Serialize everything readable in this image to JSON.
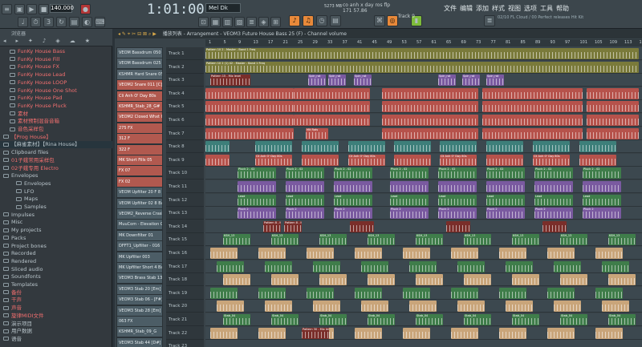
{
  "toolbar": {
    "tempo": "140.000",
    "time": "1:01:00",
    "pattern": "Mel Dk",
    "cpu": "5273 MB",
    "hint_line1": "co anh x day ros flp",
    "hint_line2": "171 57.86",
    "hint_line3": "Track 9",
    "menus": [
      "文件",
      "编辑",
      "添加",
      "样式",
      "视图",
      "选项",
      "工具",
      "帮助"
    ],
    "news": "02/10 FL Cloud / 00 Perfect releases Hit Kit"
  },
  "browser": {
    "title": "浏览器",
    "items": [
      {
        "label": "FunKy House Bass",
        "color": "red"
      },
      {
        "label": "FunKy House Fill",
        "color": "red"
      },
      {
        "label": "FunKy House FX",
        "color": "red"
      },
      {
        "label": "FunKy House Lead",
        "color": "red"
      },
      {
        "label": "FunKy House LOOP",
        "color": "red"
      },
      {
        "label": "FunKy House One Shot",
        "color": "red"
      },
      {
        "label": "FunKy House Pad",
        "color": "red"
      },
      {
        "label": "FunKy House Pluck",
        "color": "red"
      },
      {
        "label": "素材",
        "color": "red"
      },
      {
        "label": "素材预制混音音箱",
        "color": "red"
      },
      {
        "label": "音色采样包",
        "color": "red"
      },
      {
        "label": "【Prog House】",
        "color": "red"
      },
      {
        "label": "【麻雀素材】【Rina House】",
        "color": "gray",
        "selected": true
      },
      {
        "label": "Clipboard files",
        "color": "gray"
      },
      {
        "label": "01子蛾常用采样包",
        "color": "red"
      },
      {
        "label": "02子蛾专用 Electro",
        "color": "red"
      },
      {
        "label": "Envelopes",
        "color": "gray"
      },
      {
        "label": "Envelopes",
        "color": "gray"
      },
      {
        "label": "LFO",
        "color": "gray"
      },
      {
        "label": "Maps",
        "color": "gray"
      },
      {
        "label": "Samples",
        "color": "gray"
      },
      {
        "label": "Impulses",
        "color": "gray"
      },
      {
        "label": "Misc",
        "color": "gray"
      },
      {
        "label": "My projects",
        "color": "gray"
      },
      {
        "label": "Packs",
        "color": "gray"
      },
      {
        "label": "Project bones",
        "color": "gray"
      },
      {
        "label": "Recorded",
        "color": "gray"
      },
      {
        "label": "Rendered",
        "color": "gray"
      },
      {
        "label": "Sliced audio",
        "color": "gray"
      },
      {
        "label": "Soundfonts",
        "color": "gray"
      },
      {
        "label": "Templates",
        "color": "gray"
      },
      {
        "label": "备份",
        "color": "red"
      },
      {
        "label": "干声",
        "color": "red"
      },
      {
        "label": "声音",
        "color": "red"
      },
      {
        "label": "旋律MIDI文件",
        "color": "red"
      },
      {
        "label": "演示项目",
        "color": "gray"
      },
      {
        "label": "用户数据",
        "color": "gray"
      },
      {
        "label": "语音",
        "color": "gray"
      }
    ]
  },
  "playlist": {
    "title": "播放列表 - Arrangement - VEOM3 Future House Bass 25 (F) - Channel volume",
    "ruler": [
      "1",
      "5",
      "9",
      "13",
      "17",
      "21",
      "25",
      "29",
      "33",
      "37",
      "41",
      "45",
      "49",
      "53",
      "57",
      "61",
      "65",
      "69",
      "73",
      "77",
      "81",
      "85",
      "89",
      "93",
      "97",
      "101",
      "105",
      "109",
      "113",
      "117"
    ],
    "channels": [
      "VEOM Bassdrum 050",
      "VEOM Bassdrum 025",
      "KSHMR Hard Snare 05 [D]",
      "VEOM2 Snare 011 [C]",
      "Cli Anh O' Day 80s",
      "KSHMR_Stab_28_G#",
      "VEOM2 Closed Whxt 018",
      "275 FX",
      "312 F",
      "322 F",
      "MK Short Fills 05",
      "FX 07",
      "FX 02",
      "VEOM Upfilter 20 F 8 Bars",
      "VEOM Upfilter 02 8 Bars",
      "VEOM2_Reverse Crash 02",
      "MuuCom - Elevation Crys",
      "MK Downfilter 01",
      "DFFT1_Upfilter - 016",
      "MK Upfilter 003",
      "MK Upfilter Short 4 Bars 02",
      "VEOM3 Brass Stab 13 [C]",
      "VEOM3 Stab 20 [Em]",
      "VEOM3 Stab 06 - [F#]",
      "VEOM3 Stab 28 [Em]",
      "063 FX",
      "KSHMR_Stab_09_G",
      "VEOM3 Stab 44 [D#]"
    ],
    "tracks": [
      "Track 1",
      "Track 2",
      "Track 3",
      "Track 4",
      "Track 5",
      "Track 6",
      "Track 7",
      "Track 8",
      "Track 9",
      "Track 10",
      "Track 11",
      "Track 12",
      "Track 13",
      "Track 14",
      "Track 15",
      "Track 16",
      "Track 17",
      "Track 18",
      "Track 19",
      "Track 20",
      "Track 21",
      "Track 22",
      "Track 23"
    ],
    "clip_labels": {
      "t1": "Pattern 10 2 - Master - Band 1 Freq",
      "t2": "Pattern 10 2 (1) 42 - Master - Band 1 Freq",
      "t3a": "Pattern 15 - Mix level",
      "t3b": "Spin_rat",
      "t7": "Mit Rats",
      "t9": "Cli Anh O' Day 80s",
      "t10": "Pluck 2 - 02",
      "t12": "Lead",
      "t13": "Pluck 2",
      "t14": "Pattern 8 - Mix level",
      "t15": "KSH_13",
      "t21": "Stab_04",
      "t22": "Pattern 30 - Mix level"
    }
  },
  "colors": {
    "accent_orange": "#e8893a",
    "clip_red": "#b6524b",
    "clip_green": "#3f7d4a",
    "clip_purple": "#7a5aa0",
    "clip_teal": "#3d7f7a",
    "clip_olive": "#7a7a3a",
    "clip_tan": "#c9a57a",
    "clip_darkred": "#7a2e2a"
  }
}
